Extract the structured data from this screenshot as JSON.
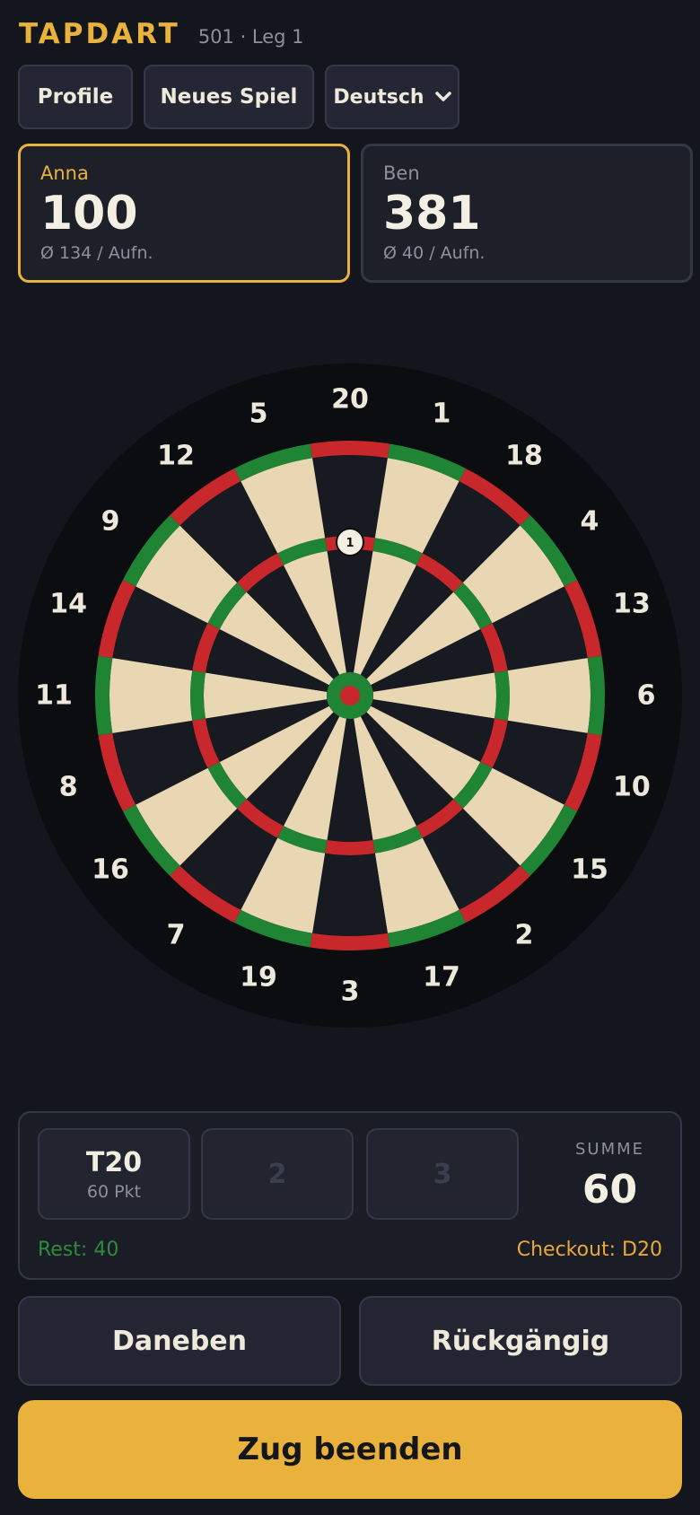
{
  "header": {
    "brand": "TAPDART",
    "subtitle": "501 · Leg 1"
  },
  "toolbar": {
    "profiles_label": "Profile",
    "new_game_label": "Neues Spiel",
    "language_value": "Deutsch"
  },
  "players": [
    {
      "name": "Anna",
      "score": "100",
      "avg": "Ø 134 / Aufn.",
      "active": true
    },
    {
      "name": "Ben",
      "score": "381",
      "avg": "Ø 40 / Aufn.",
      "active": false
    }
  ],
  "board": {
    "numbers": [
      "20",
      "1",
      "18",
      "4",
      "13",
      "6",
      "10",
      "15",
      "2",
      "17",
      "3",
      "19",
      "7",
      "16",
      "8",
      "11",
      "14",
      "9",
      "12",
      "5"
    ],
    "marker_label": "1",
    "colors": {
      "dark": "#181a21",
      "light": "#e8d7b2",
      "red": "#c8282b",
      "green": "#1f8433",
      "surround": "#0c0d10"
    }
  },
  "throws": {
    "slot1_main": "T20",
    "slot1_sub": "60 Pkt",
    "slot2_placeholder": "2",
    "slot3_placeholder": "3",
    "sum_label": "SUMME",
    "sum_value": "60",
    "rest": "Rest: 40",
    "checkout": "Checkout: D20"
  },
  "actions": {
    "miss": "Daneben",
    "undo": "Rückgängig",
    "end_turn": "Zug beenden"
  }
}
